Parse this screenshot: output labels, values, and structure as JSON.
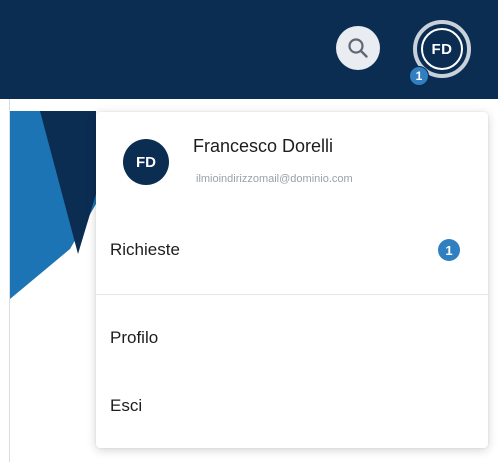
{
  "header": {
    "search_icon": "search-icon",
    "user_initials": "FD",
    "notification_count": "1"
  },
  "dropdown": {
    "avatar_initials": "FD",
    "user_name": "Francesco Dorelli",
    "user_email": "ilmioindirizzomail@dominio.com",
    "items": [
      {
        "label": "Richieste",
        "badge": "1"
      },
      {
        "label": "Profilo"
      },
      {
        "label": "Esci"
      }
    ]
  },
  "colors": {
    "navbar": "#0b2d52",
    "accent_blue": "#2f7fc1",
    "hero_dark": "#0b2d52",
    "hero_light": "#1c74b4"
  }
}
